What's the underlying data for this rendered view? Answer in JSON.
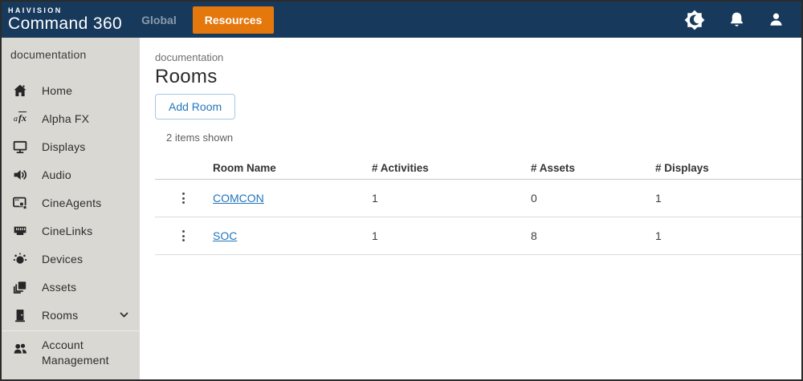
{
  "topbar": {
    "brand_line1": "HAIVISION",
    "brand_line2": "Command 360",
    "nav": [
      {
        "label": "Global",
        "active": false
      },
      {
        "label": "Resources",
        "active": true
      }
    ],
    "icons": [
      "theme-toggle-icon",
      "notifications-bell-icon",
      "user-profile-icon"
    ]
  },
  "sidebar": {
    "workspace": "documentation",
    "items": [
      {
        "label": "Home",
        "icon": "home-icon"
      },
      {
        "label": "Alpha FX",
        "icon": "alpha-fx-icon"
      },
      {
        "label": "Displays",
        "icon": "monitor-icon"
      },
      {
        "label": "Audio",
        "icon": "speaker-icon"
      },
      {
        "label": "CineAgents",
        "icon": "window-agents-icon"
      },
      {
        "label": "CineLinks",
        "icon": "ethernet-icon"
      },
      {
        "label": "Devices",
        "icon": "device-orbit-icon"
      },
      {
        "label": "Assets",
        "icon": "layers-icon"
      },
      {
        "label": "Rooms",
        "icon": "door-icon",
        "expandable": true
      }
    ],
    "footer_item": {
      "label": "Account Management",
      "icon": "users-icon"
    }
  },
  "main": {
    "breadcrumb": "documentation",
    "title": "Rooms",
    "add_room_button": "Add Room",
    "items_shown": "2 items shown",
    "table": {
      "columns": [
        "Room Name",
        "# Activities",
        "# Assets",
        "# Displays"
      ],
      "rows": [
        {
          "name": "COMCON",
          "activities": "1",
          "assets": "0",
          "displays": "1"
        },
        {
          "name": "SOC",
          "activities": "1",
          "assets": "8",
          "displays": "1"
        }
      ]
    }
  },
  "colors": {
    "topbar_navy": "#17395c",
    "accent_orange": "#e5780d",
    "sidebar_gray": "#d9d8d2",
    "link_blue": "#2176bd",
    "button_border_blue": "#a5c7e6"
  }
}
